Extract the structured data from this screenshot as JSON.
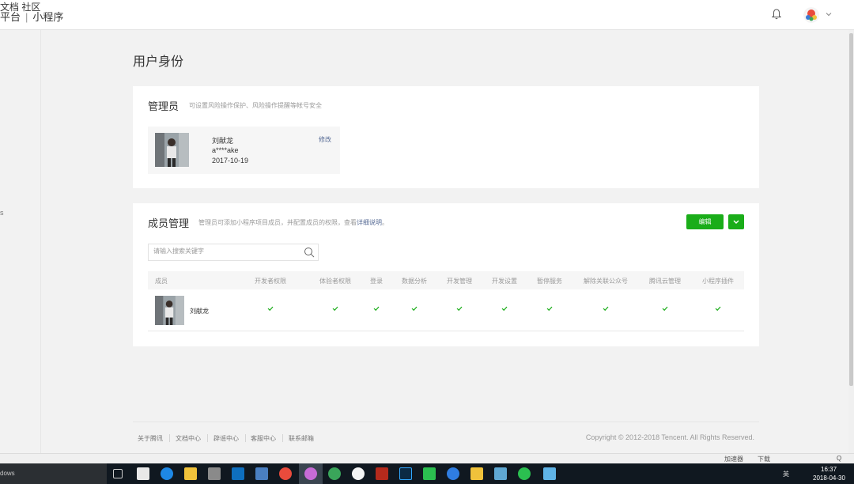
{
  "topbar": {
    "brand_left": "平台",
    "brand_sep": "|",
    "brand_right": "小程序",
    "docs": "文档",
    "community": "社区"
  },
  "sidebar": {
    "mark": "s"
  },
  "page": {
    "title": "用户身份"
  },
  "admin": {
    "title": "管理员",
    "desc": "可设置风险操作保护、风险操作提醒等帐号安全",
    "name": "刘献龙",
    "account": "a****ake",
    "date": "2017-10-19",
    "edit": "修改"
  },
  "members": {
    "title": "成员管理",
    "desc": "管理员可添加小程序项目成员，并配置成员的权限，查看",
    "desc_link": "详细说明",
    "desc_end": "。",
    "edit_button": "编辑",
    "search_placeholder": "请输入搜索关键字",
    "columns": [
      "成员",
      "开发者权限",
      "体验者权限",
      "登录",
      "数据分析",
      "开发管理",
      "开发设置",
      "暂停服务",
      "解除关联公众号",
      "腾讯云管理",
      "小程序插件"
    ],
    "rows": [
      {
        "name": "刘献龙",
        "permissions": [
          true,
          true,
          true,
          true,
          true,
          true,
          true,
          true,
          true,
          true
        ]
      }
    ]
  },
  "footer": {
    "links": [
      "关于腾讯",
      "文档中心",
      "辟谣中心",
      "客服中心",
      "联系邮箱"
    ],
    "copyright": "Copyright © 2012-2018 Tencent. All Rights Reserved."
  },
  "statusbar": {
    "accelerator": "加速器",
    "download": "下载",
    "zoom": "Q"
  },
  "taskbar": {
    "search_text": "dows",
    "tray_lang": "英",
    "time": "16:37",
    "date": "2018-04-30"
  },
  "colors": {
    "accent_green": "#1aad19",
    "link_blue": "#576b95",
    "taskbar": "#101820"
  },
  "icons": [
    "bell-icon",
    "chevron-down-icon",
    "search-icon",
    "check-icon",
    "windows-apps"
  ]
}
